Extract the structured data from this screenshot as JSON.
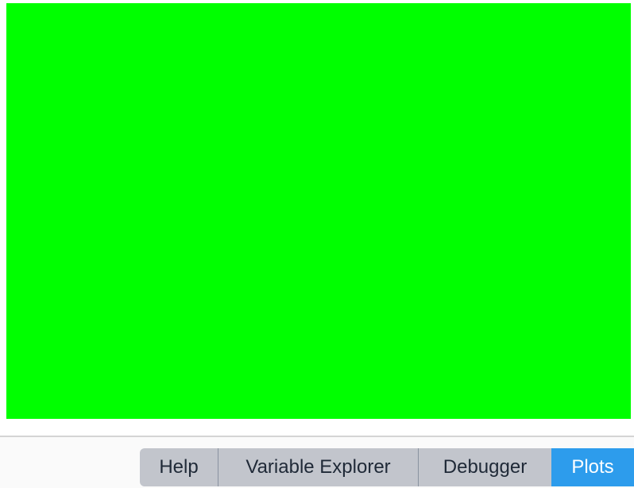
{
  "plot": {
    "fill_color": "#00ff00"
  },
  "tabs": [
    {
      "label": "Help",
      "active": false
    },
    {
      "label": "Variable Explorer",
      "active": false
    },
    {
      "label": "Debugger",
      "active": false
    },
    {
      "label": "Plots",
      "active": true
    }
  ],
  "colors": {
    "active_tab": "#2d9cec",
    "inactive_tab": "#c2c5cc"
  }
}
